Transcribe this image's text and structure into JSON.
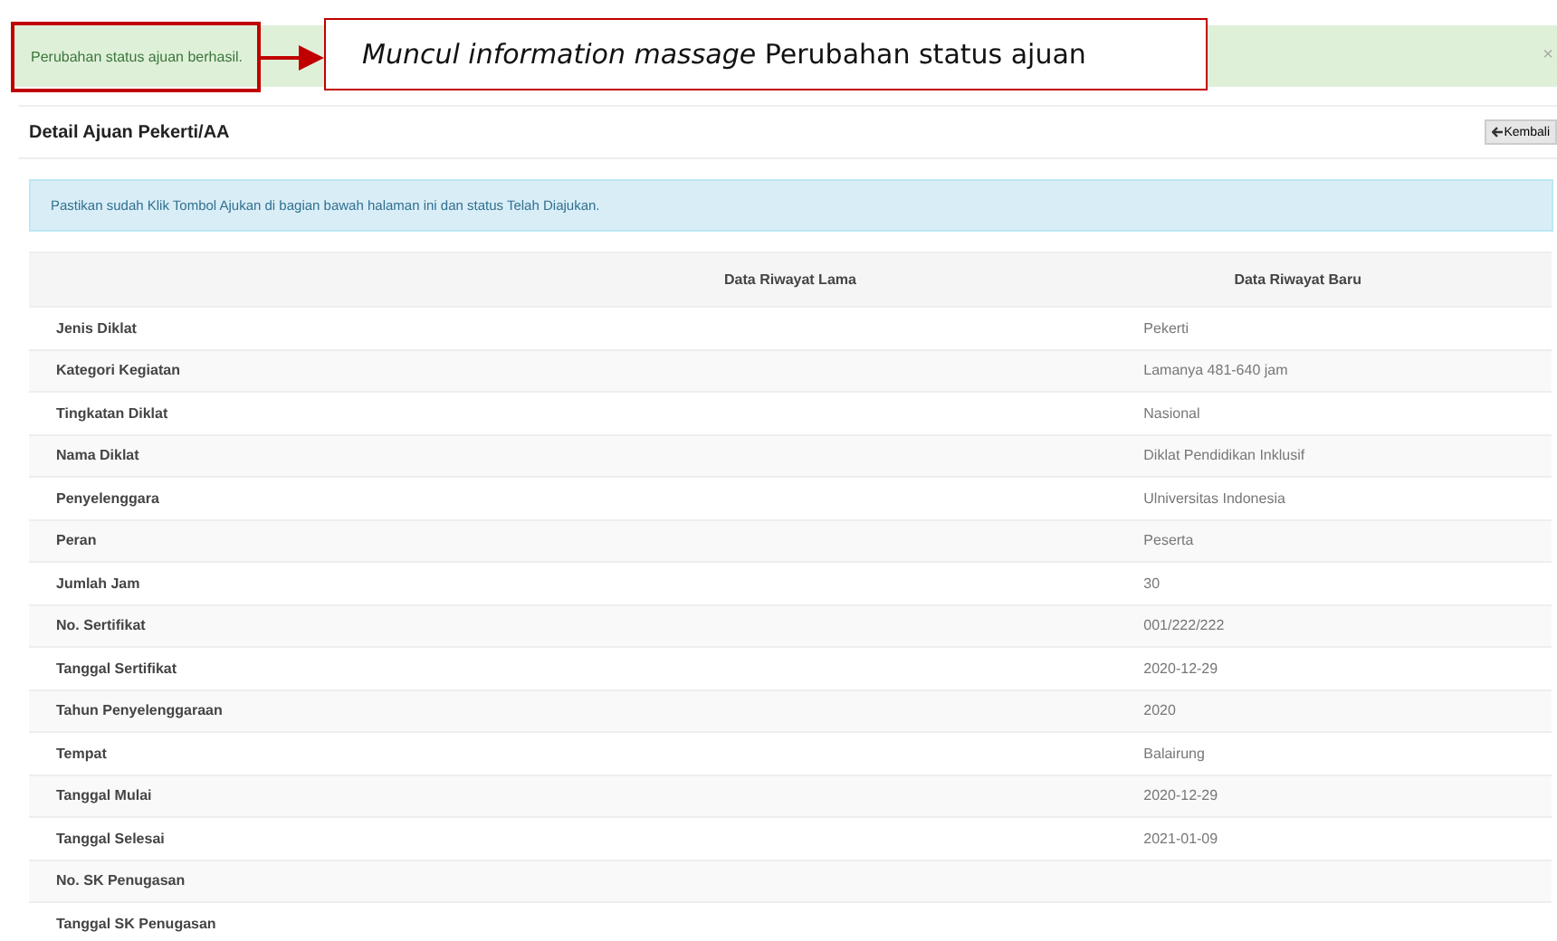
{
  "alert": {
    "message": "Perubahan status ajuan berhasil.",
    "close": "×"
  },
  "callout": {
    "text": "*Muncul information massage* Perubahan status ajuan"
  },
  "panel": {
    "title": "Detail Ajuan Pekerti/AA",
    "back_button": "Kembali"
  },
  "info": "Pastikan sudah Klik Tombol Ajukan di bagian bawah halaman ini dan status Telah Diajukan.",
  "table": {
    "columns": [
      "Data Riwayat Lama",
      "Data Riwayat Baru"
    ],
    "rows": [
      {
        "label": "Jenis Diklat",
        "new": "Pekerti"
      },
      {
        "label": "Kategori Kegiatan",
        "new": "Lamanya 481-640 jam"
      },
      {
        "label": "Tingkatan Diklat",
        "new": "Nasional"
      },
      {
        "label": "Nama Diklat",
        "new": "Diklat Pendidikan Inklusif"
      },
      {
        "label": "Penyelenggara",
        "new": "Ulniversitas Indonesia"
      },
      {
        "label": "Peran",
        "new": "Peserta"
      },
      {
        "label": "Jumlah Jam",
        "new": "30"
      },
      {
        "label": "No. Sertifikat",
        "new": "001/222/222"
      },
      {
        "label": "Tanggal Sertifikat",
        "new": "2020-12-29"
      },
      {
        "label": "Tahun Penyelenggaraan",
        "new": "2020"
      },
      {
        "label": "Tempat",
        "new": "Balairung"
      },
      {
        "label": "Tanggal Mulai",
        "new": "2020-12-29"
      },
      {
        "label": "Tanggal Selesai",
        "new": "2021-01-09"
      },
      {
        "label": "No. SK Penugasan"
      },
      {
        "label": "Tanggal SK Penugasan"
      }
    ]
  }
}
